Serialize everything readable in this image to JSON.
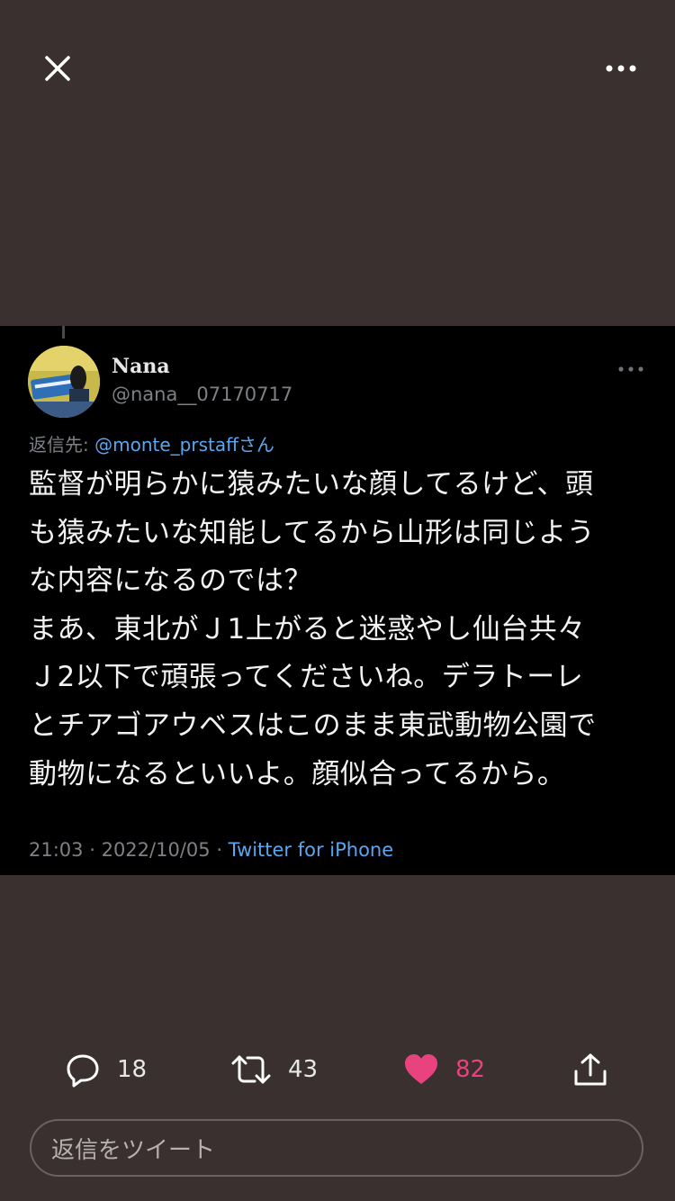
{
  "tweet": {
    "author_name": "Nana",
    "author_handle": "@nana__07170717",
    "reply_prefix": "返信先:",
    "reply_mention": "@monte_prstaff",
    "reply_suffix": "さん",
    "text_lines": [
      "監督が明らかに猿みたいな顔してるけど、頭",
      "も猿みたいな知能してるから山形は同じよう",
      "な内容になるのでは？",
      "まあ、東北がＪ1上がると迷惑やし仙台共々",
      "Ｊ2以下で頑張ってくださいね。デラトーレ",
      "とチアゴアウベスはこのまま東武動物公園で",
      "動物になるといいよ。顔似合ってるから。"
    ],
    "time": "21:03",
    "date": "2022/10/05",
    "source": "Twitter for iPhone"
  },
  "actions": {
    "replies": "18",
    "retweets": "43",
    "likes": "82"
  },
  "reply_input": {
    "placeholder": "返信をツイート"
  },
  "colors": {
    "background": "#3b3030",
    "card": "#000000",
    "link": "#5aa6f0",
    "like": "#e8437f",
    "muted": "#7d8085"
  },
  "icons": [
    "close-icon",
    "more-icon",
    "reply-icon",
    "retweet-icon",
    "like-icon",
    "share-icon"
  ]
}
